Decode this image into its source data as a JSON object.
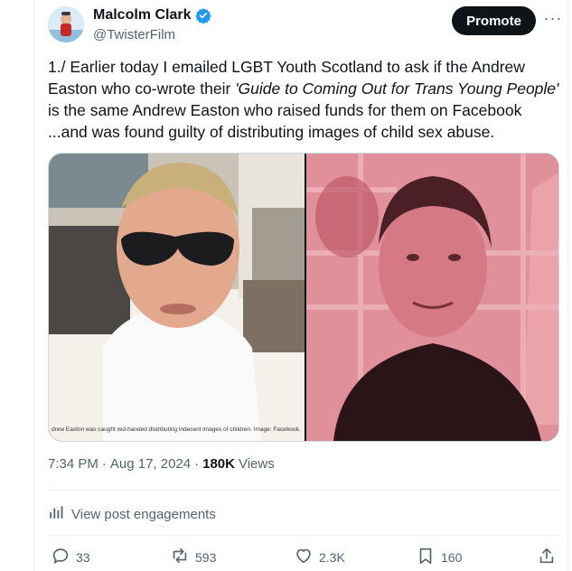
{
  "author": {
    "display_name": "Malcolm Clark",
    "handle": "@TwisterFilm",
    "verified": true
  },
  "header": {
    "promote_label": "Promote",
    "more_label": "···"
  },
  "tweet": {
    "line1": "1./ Earlier today I emailed LGBT Youth Scotland to ask if the Andrew",
    "line2_a": "Easton who co-wrote their ",
    "line2_italic": "'Guide to Coming Out for Trans Young People'",
    "line3": "is the same Andrew Easton who raised funds for them on Facebook",
    "line4": "...and was found guilty of distributing images of child sex abuse."
  },
  "media": {
    "caption": "drew Easton was caught red-handed distributing indecent images of children. Image: Facebook."
  },
  "meta": {
    "time": "7:34 PM",
    "dot1": "·",
    "date": "Aug 17, 2024",
    "dot2": "·",
    "views_count": "180K",
    "views_label": "Views"
  },
  "engagements_label": "View post engagements",
  "actions": {
    "replies": "33",
    "reposts": "593",
    "likes": "2.3K",
    "bookmarks": "160"
  },
  "colors": {
    "text": "#0f1419",
    "secondary": "#536471",
    "verified_blue": "#1d9bf0",
    "border": "#cfd9de"
  }
}
